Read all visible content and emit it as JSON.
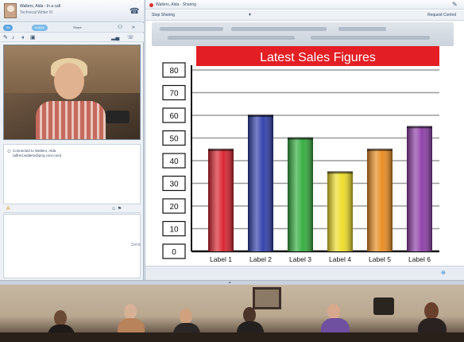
{
  "contact": {
    "name": "Walters, Alda - In a call",
    "title": "Technical Writer III"
  },
  "toolbar": {
    "pill_label": "IM",
    "pill2_label": "Invites",
    "share_label": "Share"
  },
  "chat": {
    "line1": "Connected to Walters, Alda",
    "line2": "(alfred.walters@proj.com.com)"
  },
  "compose": {
    "send_label": "Send"
  },
  "share": {
    "window_title": "Walters, Alda - Sharing",
    "stop_label": "Stop Sharing",
    "request_control_label": "Request Control"
  },
  "chart_data": {
    "type": "bar",
    "title": "Latest Sales Figures",
    "categories": [
      "Label 1",
      "Label 2",
      "Label 3",
      "Label 4",
      "Label 5",
      "Label 6"
    ],
    "values": [
      45,
      60,
      50,
      35,
      45,
      55
    ],
    "ylim": [
      0,
      80
    ],
    "yticks": [
      0,
      10,
      20,
      30,
      40,
      50,
      60,
      70,
      80
    ],
    "grid": true,
    "bar_colors": [
      "#d81e2a",
      "#2c3aa8",
      "#2faa3a",
      "#eddc23",
      "#e98a1c",
      "#8b3aa6"
    ],
    "title_bg": "#e31e24",
    "xlabel": "",
    "ylabel": ""
  }
}
